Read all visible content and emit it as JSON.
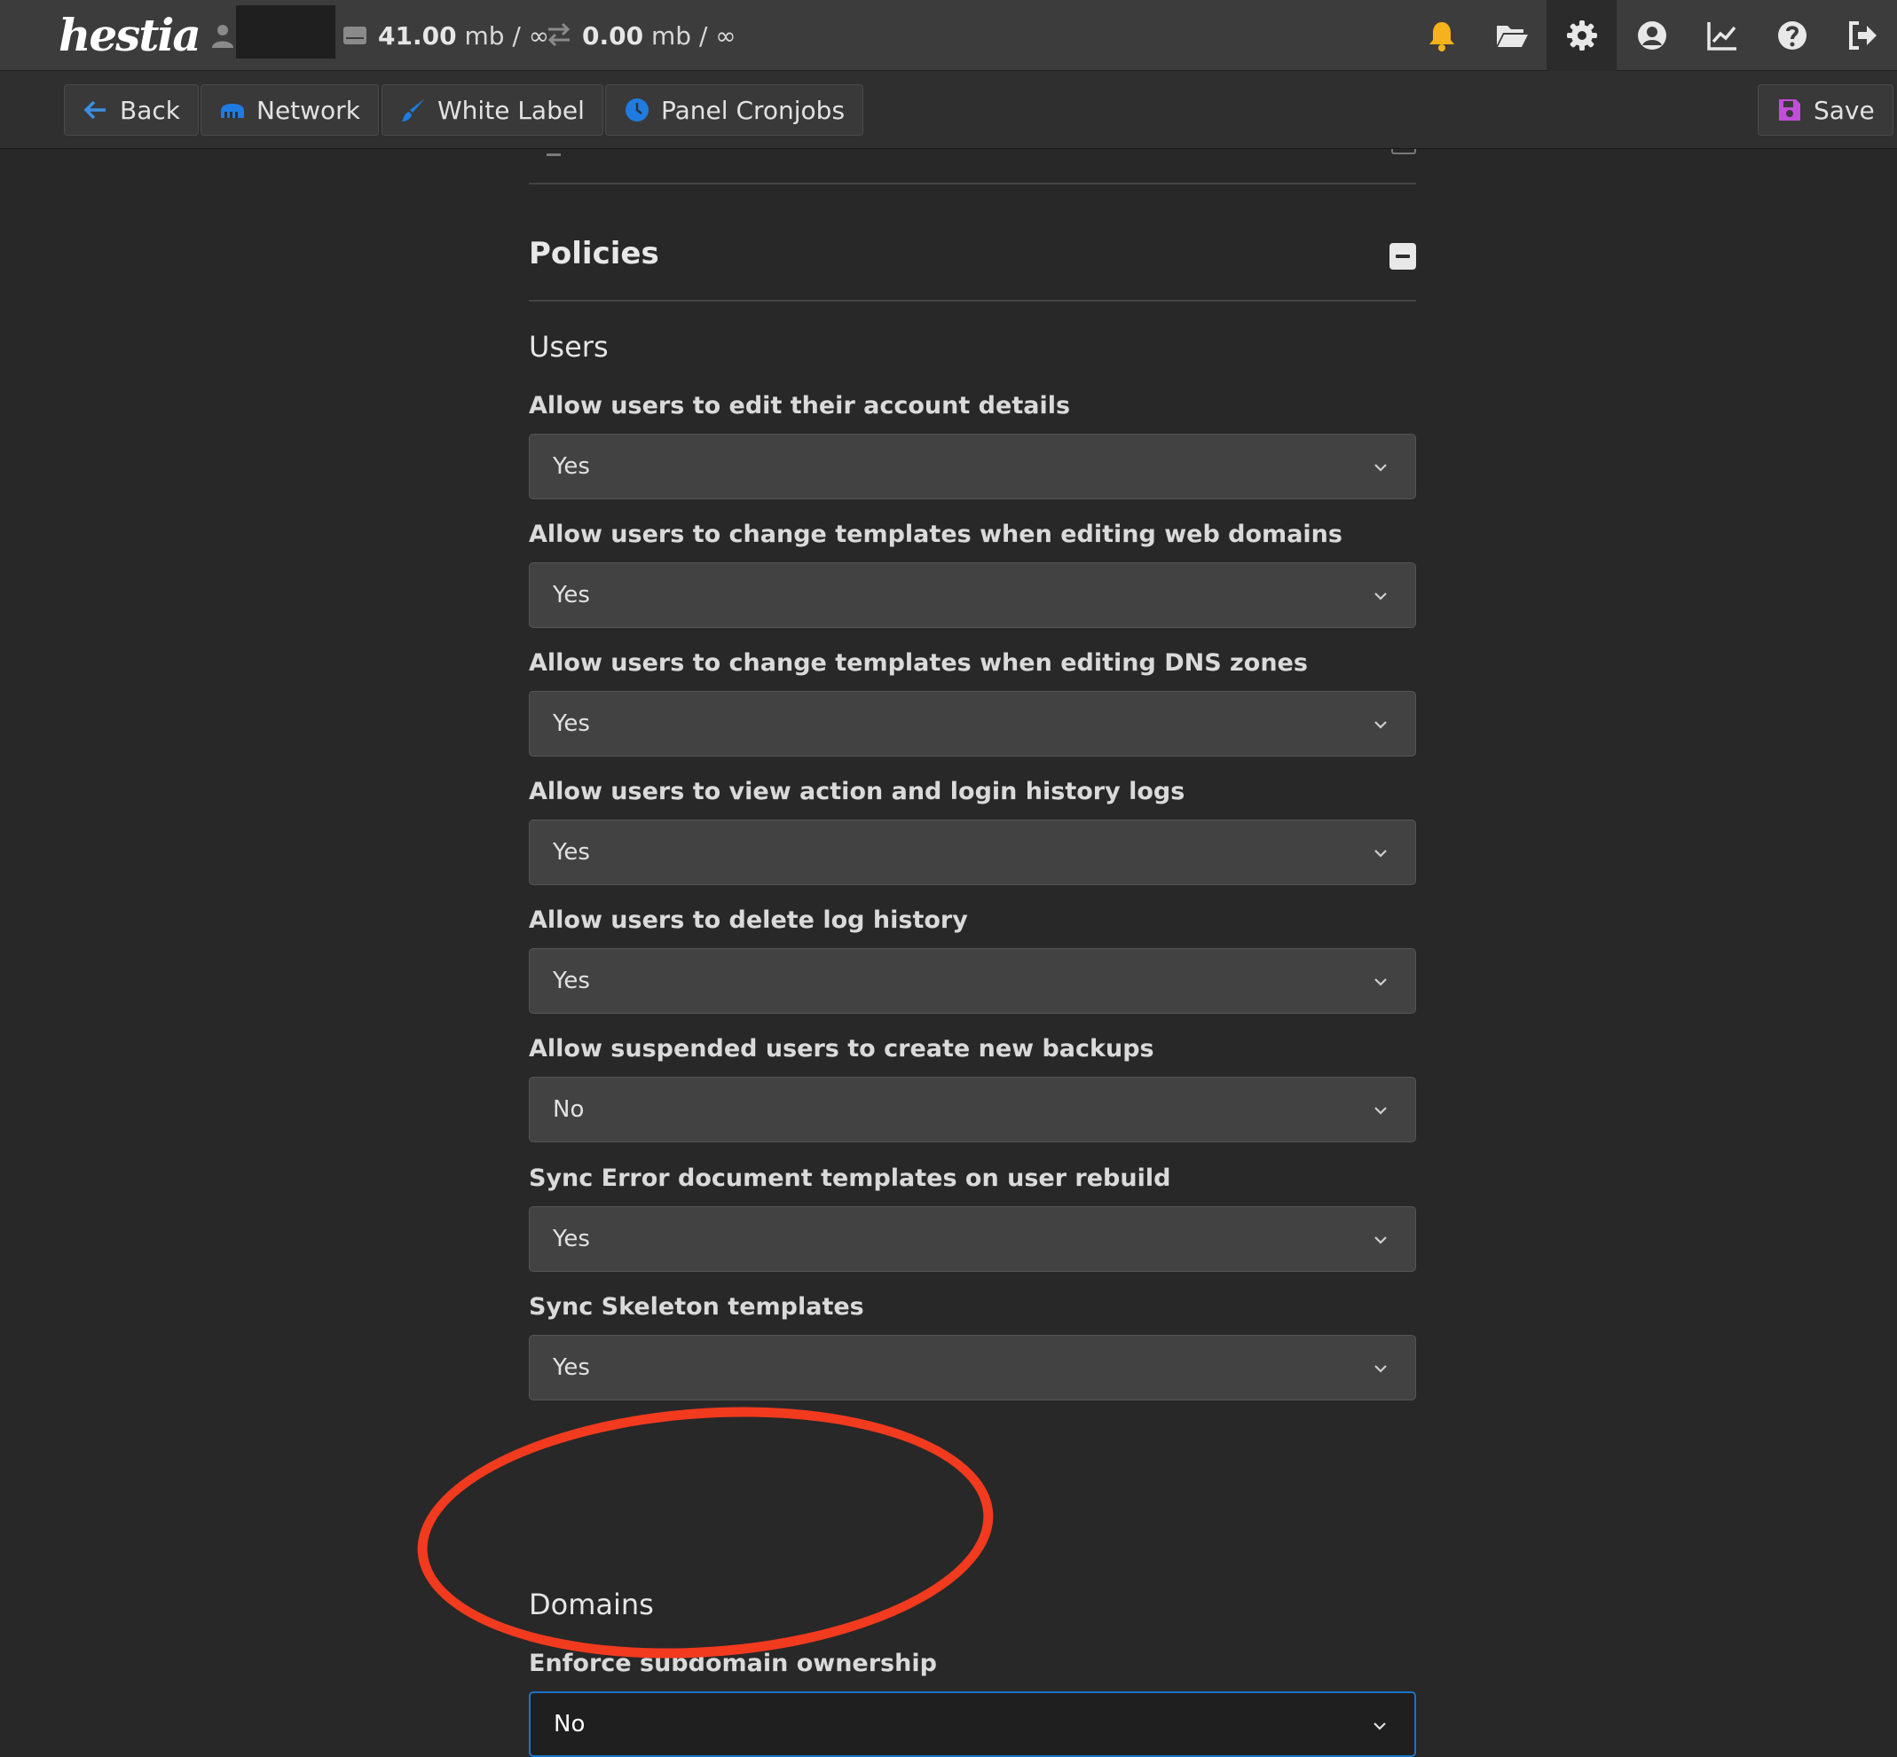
{
  "app": {
    "logo": "hestia"
  },
  "topbar": {
    "disk_value": "41.00",
    "disk_unit": " mb / ∞",
    "bandwidth_value": "0.00",
    "bandwidth_unit": " mb / ∞",
    "icons": [
      "bell-icon",
      "folder-open-icon",
      "gear-icon",
      "user-circle-icon",
      "chart-line-icon",
      "question-icon",
      "logout-icon"
    ]
  },
  "toolbar": {
    "back_label": "Back",
    "network_label": "Network",
    "white_label_label": "White Label",
    "panel_cronjobs_label": "Panel Cronjobs",
    "save_label": "Save"
  },
  "policies": {
    "title": "Policies",
    "users": {
      "title": "Users",
      "fields": [
        {
          "label": "Allow users to edit their account details",
          "value": "Yes"
        },
        {
          "label": "Allow users to change templates when editing web domains",
          "value": "Yes"
        },
        {
          "label": "Allow users to change templates when editing DNS zones",
          "value": "Yes"
        },
        {
          "label": "Allow users to view action and login history logs",
          "value": "Yes"
        },
        {
          "label": "Allow users to delete log history",
          "value": "Yes"
        },
        {
          "label": "Allow suspended users to create new backups",
          "value": "No"
        },
        {
          "label": "Sync Error document templates on user rebuild",
          "value": "Yes"
        },
        {
          "label": "Sync Skeleton templates",
          "value": "Yes"
        }
      ]
    },
    "domains": {
      "title": "Domains",
      "fields": [
        {
          "label": "Enforce subdomain ownership",
          "value": "No"
        }
      ]
    }
  },
  "colors": {
    "accent": "#1a73c8",
    "annotation": "#f23a1e",
    "bell": "#f6b21c",
    "save_icon": "#c04ed8"
  }
}
